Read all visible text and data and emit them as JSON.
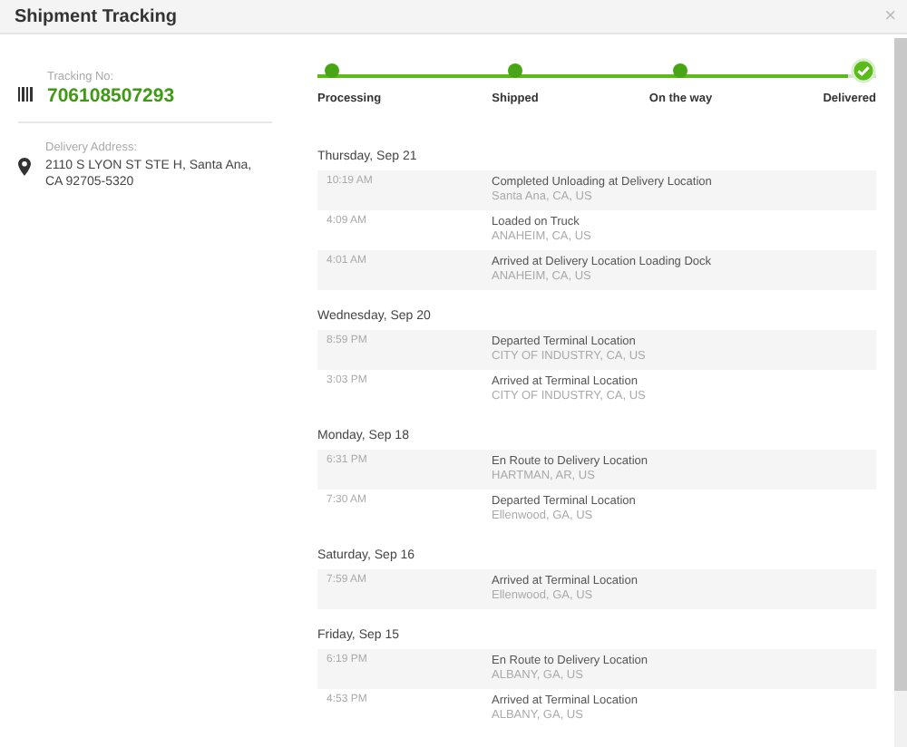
{
  "window": {
    "title": "Shipment Tracking",
    "close": "×"
  },
  "tracking": {
    "label": "Tracking No:",
    "number": "706108507293"
  },
  "address": {
    "label": "Delivery Address:",
    "value": "2110 S LYON ST STE H, Santa Ana, CA 92705-5320"
  },
  "progress": {
    "steps": [
      {
        "label": "Processing",
        "kind": "dot"
      },
      {
        "label": "Shipped",
        "kind": "dot"
      },
      {
        "label": "On the way",
        "kind": "dot"
      },
      {
        "label": "Delivered",
        "kind": "check"
      }
    ]
  },
  "days": [
    {
      "date": "Thursday, Sep 21",
      "events": [
        {
          "time": "10:19 AM",
          "status": "Completed Unloading at Delivery Location",
          "location": "Santa Ana, CA, US"
        },
        {
          "time": "4:09 AM",
          "status": "Loaded on Truck",
          "location": "ANAHEIM, CA, US"
        },
        {
          "time": "4:01 AM",
          "status": "Arrived at Delivery Location Loading Dock",
          "location": "ANAHEIM, CA, US"
        }
      ]
    },
    {
      "date": "Wednesday, Sep 20",
      "events": [
        {
          "time": "8:59 PM",
          "status": "Departed Terminal Location",
          "location": "CITY OF INDUSTRY, CA, US"
        },
        {
          "time": "3:03 PM",
          "status": "Arrived at Terminal Location",
          "location": "CITY OF INDUSTRY, CA, US"
        }
      ]
    },
    {
      "date": "Monday, Sep 18",
      "events": [
        {
          "time": "6:31 PM",
          "status": "En Route to Delivery Location",
          "location": "HARTMAN, AR, US"
        },
        {
          "time": "7:30 AM",
          "status": "Departed Terminal Location",
          "location": "Ellenwood, GA, US"
        }
      ]
    },
    {
      "date": "Saturday, Sep 16",
      "events": [
        {
          "time": "7:59 AM",
          "status": "Arrived at Terminal Location",
          "location": "Ellenwood, GA, US"
        }
      ]
    },
    {
      "date": "Friday, Sep 15",
      "events": [
        {
          "time": "6:19 PM",
          "status": "En Route to Delivery Location",
          "location": "ALBANY, GA, US"
        },
        {
          "time": "4:53 PM",
          "status": "Arrived at Terminal Location",
          "location": "ALBANY, GA, US"
        }
      ]
    }
  ]
}
